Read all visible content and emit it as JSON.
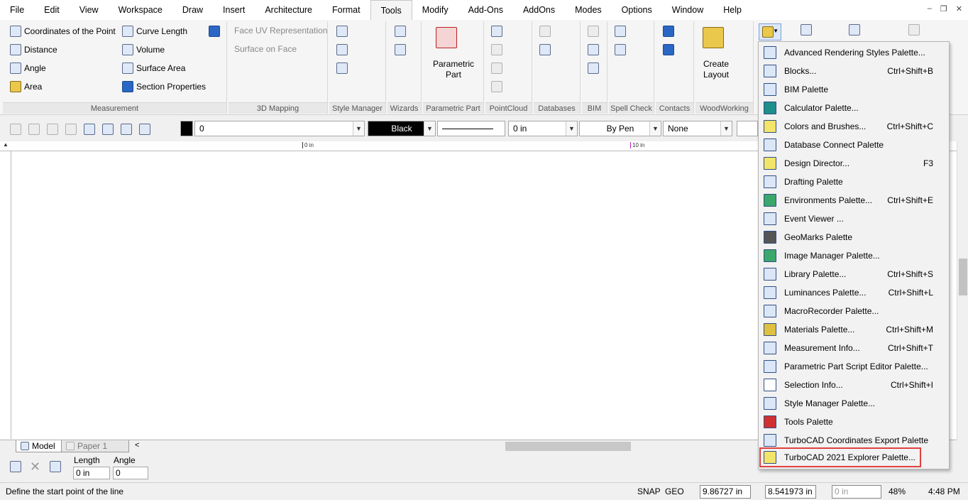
{
  "menu": [
    "File",
    "Edit",
    "View",
    "Workspace",
    "Draw",
    "Insert",
    "Architecture",
    "Format",
    "Tools",
    "Modify",
    "Add-Ons",
    "AddOns",
    "Modes",
    "Options",
    "Window",
    "Help"
  ],
  "active_menu": "Tools",
  "ribbon": {
    "measurement": {
      "items": [
        "Coordinates of the Point",
        "Distance",
        "Angle",
        "Area",
        "Curve Length",
        "Volume",
        "Surface Area",
        "Section Properties"
      ],
      "label": "Measurement"
    },
    "mapping": {
      "items": [
        "Face UV Representation",
        "Surface on Face"
      ],
      "label": "3D Mapping"
    },
    "style_manager": {
      "label": "Style Manager"
    },
    "wizards": {
      "label": "Wizards"
    },
    "parametric_part": {
      "button": "Parametric Part",
      "label": "Parametric Part"
    },
    "pointcloud": {
      "label": "PointCloud"
    },
    "databases": {
      "label": "Databases"
    },
    "bim": {
      "label": "BIM"
    },
    "spell_check": {
      "label": "Spell Check"
    },
    "contacts": {
      "label": "Contacts"
    },
    "woodworking": {
      "button": "Create Layout",
      "label": "WoodWorking"
    }
  },
  "toolbar": {
    "layer_value": "0",
    "color_value": "Black",
    "thickness_value": "0 in",
    "pen_value": "By Pen",
    "pattern_value": "None"
  },
  "ruler": {
    "mark0": "0 in",
    "mark10": "10 in"
  },
  "tabs": {
    "model": "Model",
    "paper": "Paper 1"
  },
  "inputbar": {
    "length_label": "Length",
    "length_value": "0 in",
    "angle_label": "Angle",
    "angle_value": "0"
  },
  "status": {
    "prompt": "Define the start point of the line",
    "snap": "SNAP",
    "geo": "GEO",
    "x_value": "9.86727 in",
    "y_value": "8.541973 in",
    "z_value": "0 in",
    "zoom": "48%",
    "time": "4:48 PM"
  },
  "dropdown": [
    {
      "label": "Advanced Rendering Styles Palette...",
      "shortcut": ""
    },
    {
      "label": "Blocks...",
      "shortcut": "Ctrl+Shift+B"
    },
    {
      "label": "BIM Palette",
      "shortcut": ""
    },
    {
      "label": "Calculator Palette...",
      "shortcut": ""
    },
    {
      "label": "Colors and Brushes...",
      "shortcut": "Ctrl+Shift+C"
    },
    {
      "label": "Database Connect Palette",
      "shortcut": ""
    },
    {
      "label": "Design Director...",
      "shortcut": "F3"
    },
    {
      "label": "Drafting Palette",
      "shortcut": ""
    },
    {
      "label": "Environments Palette...",
      "shortcut": "Ctrl+Shift+E"
    },
    {
      "label": "Event Viewer ...",
      "shortcut": ""
    },
    {
      "label": "GeoMarks Palette",
      "shortcut": ""
    },
    {
      "label": "Image Manager Palette...",
      "shortcut": ""
    },
    {
      "label": "Library Palette...",
      "shortcut": "Ctrl+Shift+S"
    },
    {
      "label": "Luminances Palette...",
      "shortcut": "Ctrl+Shift+L"
    },
    {
      "label": "MacroRecorder Palette...",
      "shortcut": ""
    },
    {
      "label": "Materials Palette...",
      "shortcut": "Ctrl+Shift+M"
    },
    {
      "label": "Measurement Info...",
      "shortcut": "Ctrl+Shift+T"
    },
    {
      "label": "Parametric Part Script Editor Palette...",
      "shortcut": ""
    },
    {
      "label": "Selection Info...",
      "shortcut": "Ctrl+Shift+I"
    },
    {
      "label": "Style Manager Palette...",
      "shortcut": ""
    },
    {
      "label": "Tools Palette",
      "shortcut": ""
    },
    {
      "label": "TurboCAD Coordinates Export Palette",
      "shortcut": ""
    },
    {
      "label": "TurboCAD 2021 Explorer Palette...",
      "shortcut": ""
    }
  ],
  "highlight_color": "#e04040"
}
